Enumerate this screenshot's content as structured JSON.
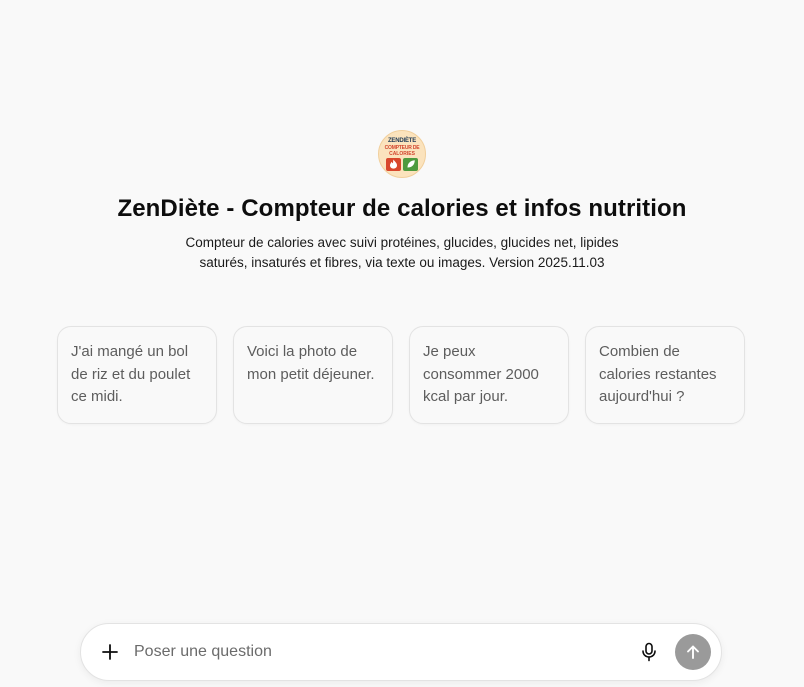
{
  "header": {
    "logo": {
      "line1": "ZENDIÈTE",
      "line2": "COMPTEUR DE",
      "line3": "CALORIES",
      "icons": [
        "fire-icon",
        "leaf-icon"
      ]
    },
    "title": "ZenDiète - Compteur de calories et infos nutrition",
    "description": "Compteur de calories avec suivi protéines, glucides, glucides net, lipides saturés, insaturés et fibres, via texte ou images. Version 2025.11.03"
  },
  "suggestions": [
    {
      "text": "J'ai mangé un bol de riz et du poulet ce midi."
    },
    {
      "text": "Voici la photo de mon petit déjeuner."
    },
    {
      "text": "Je peux consommer 2000 kcal par jour."
    },
    {
      "text": "Combien de calories restantes aujourd'hui ?"
    }
  ],
  "composer": {
    "placeholder": "Poser une question",
    "value": "",
    "icons": [
      "plus-icon",
      "microphone-icon",
      "arrow-up-icon"
    ]
  },
  "colors": {
    "background": "#f9f9f9",
    "card_border": "#e3e3e3",
    "send_button": "#9a9a9a",
    "logo_background": "#fbe3bd"
  }
}
